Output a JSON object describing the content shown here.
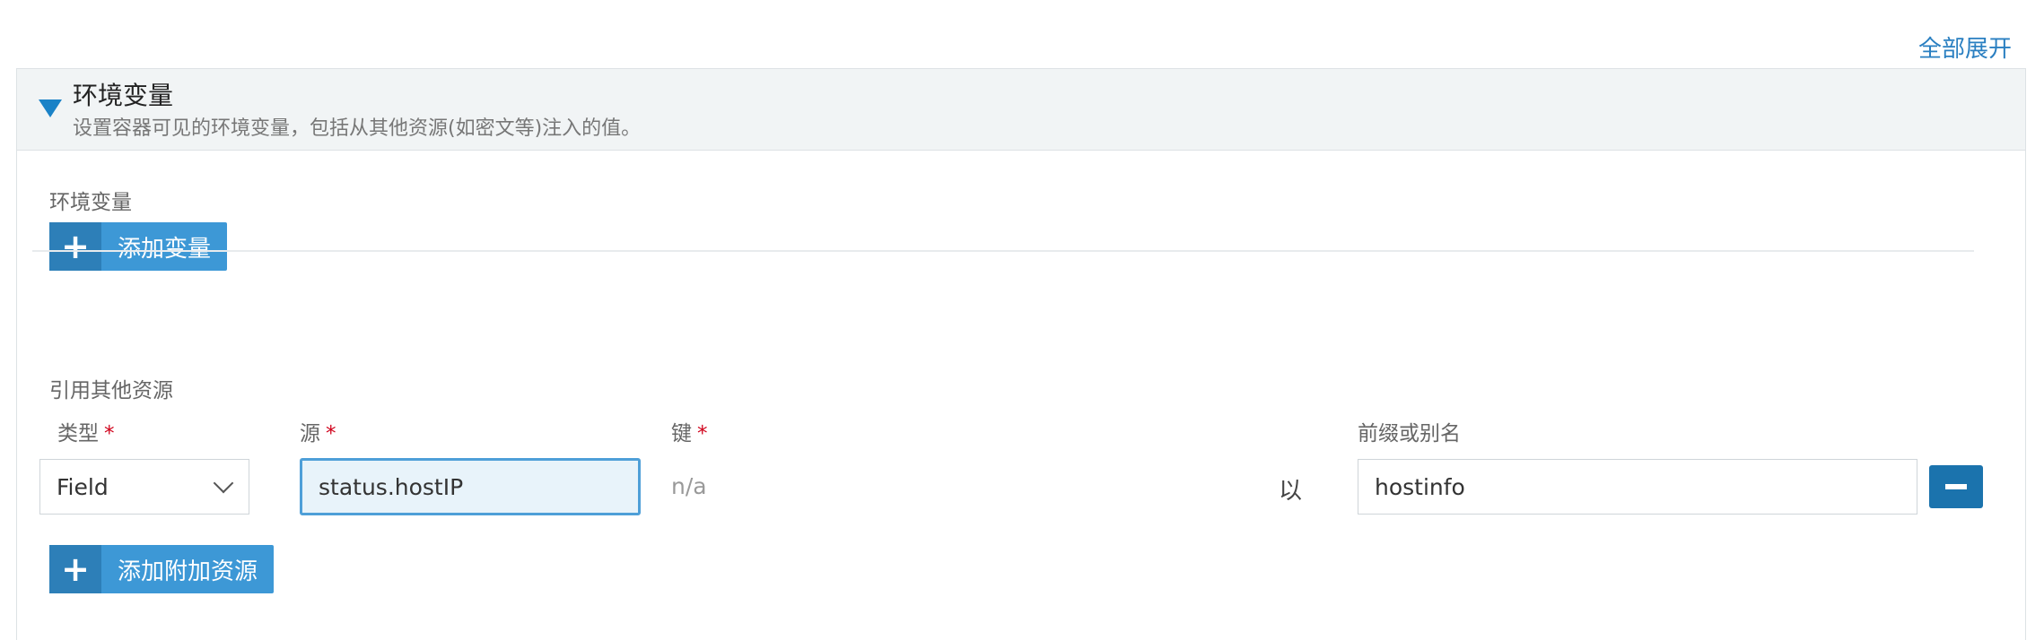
{
  "expand_all": "全部展开",
  "section": {
    "title": "环境变量",
    "description": "设置容器可见的环境变量，包括从其他资源(如密文等)注入的值。"
  },
  "env": {
    "label": "环境变量",
    "add_button": "添加变量"
  },
  "refs": {
    "label": "引用其他资源",
    "columns": {
      "type": "类型",
      "source": "源",
      "key": "键",
      "alias": "前缀或别名",
      "required_mark": "*"
    },
    "row": {
      "type_value": "Field",
      "source_value": "status.hostIP",
      "key_value": "n/a",
      "with_text": "以",
      "alias_value": "hostinfo"
    },
    "add_button": "添加附加资源"
  },
  "colors": {
    "accent": "#3d98d6",
    "accent_dark": "#2d7fb8",
    "link": "#2a7fc1",
    "required": "#d0021b"
  }
}
